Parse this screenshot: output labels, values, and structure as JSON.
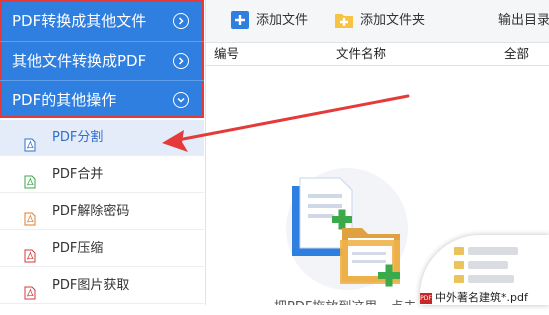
{
  "sidebar": {
    "categories": [
      {
        "label": "PDF转换成其他文件",
        "icon": "chevron-right-circle-icon"
      },
      {
        "label": "其他文件转换成PDF",
        "icon": "chevron-right-circle-icon"
      },
      {
        "label": "PDF的其他操作",
        "icon": "chevron-down-circle-icon"
      }
    ],
    "subitems": [
      {
        "label": "PDF分割",
        "active": true
      },
      {
        "label": "PDF合并",
        "active": false
      },
      {
        "label": "PDF解除密码",
        "active": false
      },
      {
        "label": "PDF压缩",
        "active": false
      },
      {
        "label": "PDF图片获取",
        "active": false
      }
    ]
  },
  "toolbar": {
    "add_file": "添加文件",
    "add_folder": "添加文件夹",
    "output_dir": "输出目录"
  },
  "table": {
    "col_no": "编号",
    "col_name": "文件名称",
    "col_all": "全部"
  },
  "canvas": {
    "hint": "把PDF拖放到这里，点击",
    "drag_file": "中外著名建筑*.pdf"
  },
  "colors": {
    "accent": "#2f7fe0",
    "highlight_border": "#e53a3a",
    "active_item_bg": "#e3ecf8"
  }
}
